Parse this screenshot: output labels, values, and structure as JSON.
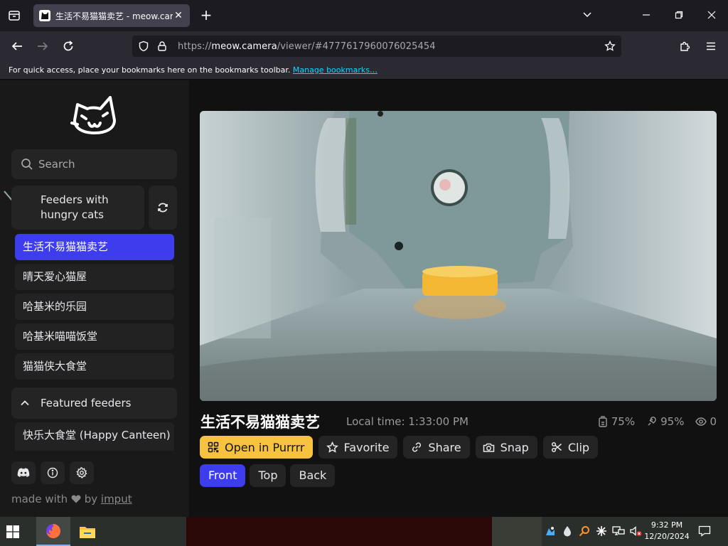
{
  "browser": {
    "tab_title": "生活不易猫猫卖艺 - meow.camera",
    "tab_close": "✕",
    "new_tab": "+",
    "url_prefix": "https://",
    "url_host": "meow.camera",
    "url_path": "/viewer/#4777617960076025454",
    "bookmarks_text": "For quick access, place your bookmarks here on the bookmarks toolbar.",
    "bookmarks_link": "Manage bookmarks…"
  },
  "sidebar": {
    "search_placeholder": "Search",
    "section_title": "Feeders with hungry cats",
    "feeders": [
      {
        "label": "生活不易猫猫卖艺",
        "active": true
      },
      {
        "label": "晴天爱心猫屋",
        "active": false
      },
      {
        "label": "哈基米的乐园",
        "active": false
      },
      {
        "label": "哈基米喵喵饭堂",
        "active": false
      },
      {
        "label": "猫猫侠大食堂",
        "active": false
      }
    ],
    "featured_title": "Featured feeders",
    "featured_item": "快乐大食堂 (Happy Canteen)",
    "made_with_prefix": "made with",
    "made_with_by": "by",
    "made_with_link": "imput"
  },
  "viewer": {
    "title": "生活不易猫猫卖艺",
    "local_time": "Local time: 1:33:00 PM",
    "food_level": "75%",
    "battery_level": "95%",
    "viewers": "0",
    "actions": {
      "open": "Open in Purrrr",
      "favorite": "Favorite",
      "share": "Share",
      "snap": "Snap",
      "clip": "Clip"
    },
    "views": [
      {
        "label": "Front",
        "active": true
      },
      {
        "label": "Top",
        "active": false
      },
      {
        "label": "Back",
        "active": false
      }
    ]
  },
  "taskbar": {
    "time": "9:32 PM",
    "date": "12/20/2024"
  },
  "colors": {
    "accent": "#3d3ded",
    "primary_button": "#f7c23e"
  }
}
